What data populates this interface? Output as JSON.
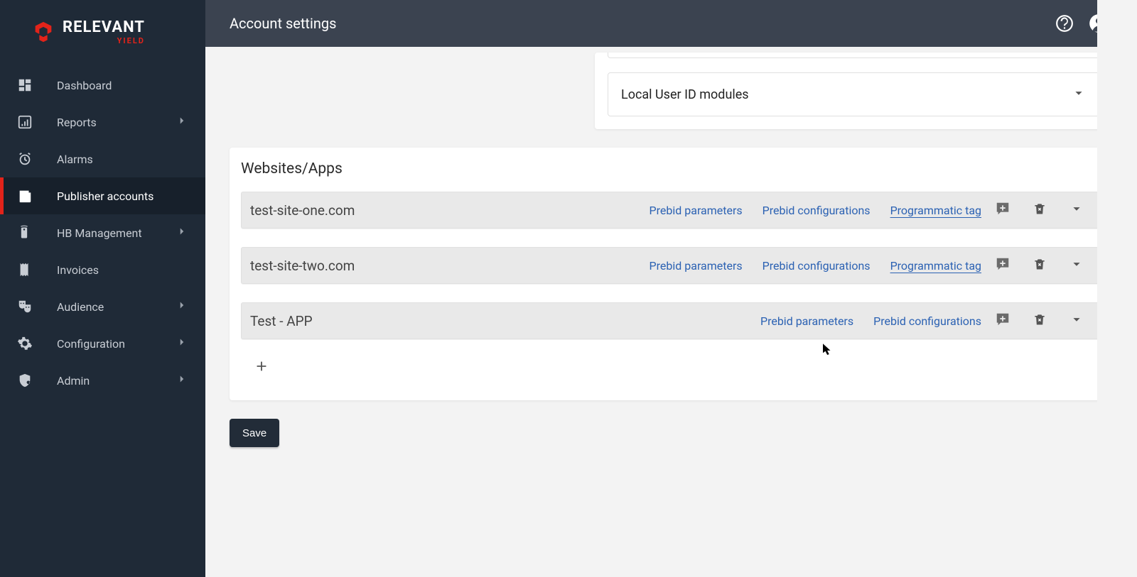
{
  "brand": {
    "name": "RELEVANT",
    "sub": "YIELD"
  },
  "header": {
    "title": "Account settings"
  },
  "sidebar": {
    "items": [
      {
        "label": "Dashboard",
        "icon": "dashboard-icon",
        "hasChevron": false
      },
      {
        "label": "Reports",
        "icon": "bar-chart-icon",
        "hasChevron": true
      },
      {
        "label": "Alarms",
        "icon": "alarm-icon",
        "hasChevron": false
      },
      {
        "label": "Publisher accounts",
        "icon": "newspaper-icon",
        "hasChevron": false,
        "active": true
      },
      {
        "label": "HB Management",
        "icon": "remote-icon",
        "hasChevron": true
      },
      {
        "label": "Invoices",
        "icon": "receipt-icon",
        "hasChevron": false
      },
      {
        "label": "Audience",
        "icon": "theater-icon",
        "hasChevron": true
      },
      {
        "label": "Configuration",
        "icon": "gear-icon",
        "hasChevron": true
      },
      {
        "label": "Admin",
        "icon": "shield-icon",
        "hasChevron": true
      }
    ]
  },
  "upper": {
    "accordion_label": "Local User ID modules"
  },
  "panel": {
    "title": "Websites/Apps",
    "links": {
      "prebid_params": "Prebid parameters",
      "prebid_configs": "Prebid configurations",
      "programmatic": "Programmatic tag"
    },
    "sites": [
      {
        "name": "test-site-one.com",
        "showProgrammatic": true
      },
      {
        "name": "test-site-two.com",
        "showProgrammatic": true
      },
      {
        "name": "Test - APP",
        "showProgrammatic": false
      }
    ]
  },
  "buttons": {
    "save": "Save"
  }
}
